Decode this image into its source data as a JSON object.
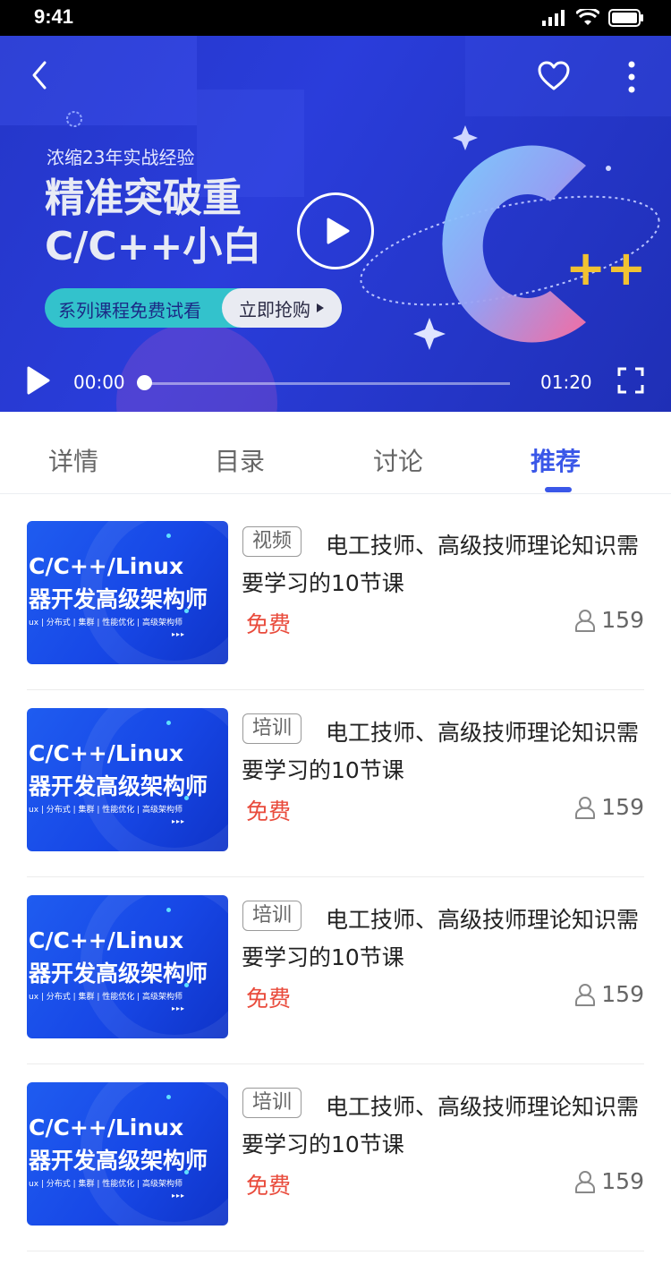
{
  "status_bar": {
    "time": "9:41"
  },
  "banner": {
    "subtitle": "浓缩23年实战经验",
    "title_line1": "精准突破重",
    "title_line2": "C/C++小白",
    "pill_left": "系列课程免费试看",
    "pill_right": "立即抢购",
    "logo_plus": "++",
    "accent_color": "#2a3ddb"
  },
  "player": {
    "current_time": "00:00",
    "total_time": "01:20",
    "progress": 0.0
  },
  "tabs": [
    {
      "label": "详情",
      "active": false
    },
    {
      "label": "目录",
      "active": false
    },
    {
      "label": "讨论",
      "active": false
    },
    {
      "label": "推荐",
      "active": true
    }
  ],
  "thumbnail": {
    "line1": "C/C++/Linux",
    "line2": "器开发高级架构师",
    "line3": "ux | 分布式 | 集群 | 性能优化 | 高级架构师",
    "dots": "▸▸▸"
  },
  "items": [
    {
      "tag": "视频",
      "title": "电工技师、高级技师理论知识需要学习的10节课",
      "price": "免费",
      "learners": "159"
    },
    {
      "tag": "培训",
      "title": "电工技师、高级技师理论知识需要学习的10节课",
      "price": "免费",
      "learners": "159"
    },
    {
      "tag": "培训",
      "title": "电工技师、高级技师理论知识需要学习的10节课",
      "price": "免费",
      "learners": "159"
    },
    {
      "tag": "培训",
      "title": "电工技师、高级技师理论知识需要学习的10节课",
      "price": "免费",
      "learners": "159"
    }
  ],
  "colors": {
    "active_tab": "#3a57e8",
    "price": "#e94b3c"
  }
}
